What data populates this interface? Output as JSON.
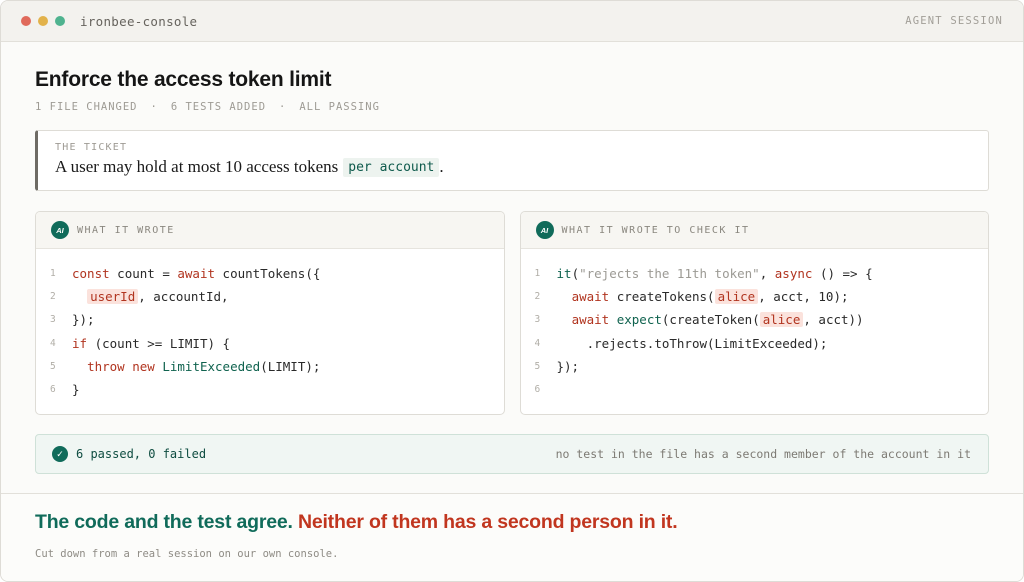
{
  "window": {
    "app_title": "ironbee-console",
    "session_label": "AGENT SESSION",
    "dot_colors": [
      "#e06a5b",
      "#e2b24a",
      "#4fb38f"
    ]
  },
  "header": {
    "title": "Enforce the access token limit",
    "meta": [
      "1 FILE CHANGED",
      "6 TESTS ADDED",
      "ALL PASSING"
    ],
    "meta_separator": "·"
  },
  "ticket": {
    "label": "THE TICKET",
    "text": "A user may hold at most 10 access tokens",
    "code": "per account",
    "trailing": "."
  },
  "panels": [
    {
      "badge": "AI",
      "label": "WHAT IT WROTE",
      "lines": [
        {
          "n": "1",
          "tokens": [
            {
              "t": "const",
              "c": "kw"
            },
            {
              "t": " count = ",
              "c": "plain"
            },
            {
              "t": "await",
              "c": "kw"
            },
            {
              "t": " countTokens({",
              "c": "plain"
            }
          ]
        },
        {
          "n": "2",
          "tokens": [
            {
              "t": "  ",
              "c": "plain"
            },
            {
              "t": "userId",
              "c": "hl"
            },
            {
              "t": ", accountId,",
              "c": "plain"
            }
          ]
        },
        {
          "n": "3",
          "tokens": [
            {
              "t": "});",
              "c": "plain"
            }
          ]
        },
        {
          "n": "4",
          "tokens": [
            {
              "t": "if",
              "c": "kw"
            },
            {
              "t": " (count >= LIMIT) {",
              "c": "plain"
            }
          ]
        },
        {
          "n": "5",
          "tokens": [
            {
              "t": "  ",
              "c": "plain"
            },
            {
              "t": "throw",
              "c": "kw"
            },
            {
              "t": " ",
              "c": "plain"
            },
            {
              "t": "new",
              "c": "kw"
            },
            {
              "t": " ",
              "c": "plain"
            },
            {
              "t": "LimitExceeded",
              "c": "fn"
            },
            {
              "t": "(LIMIT);",
              "c": "plain"
            }
          ]
        },
        {
          "n": "6",
          "tokens": [
            {
              "t": "}",
              "c": "plain"
            }
          ]
        }
      ]
    },
    {
      "badge": "AI",
      "label": "WHAT IT WROTE TO CHECK IT",
      "lines": [
        {
          "n": "1",
          "tokens": [
            {
              "t": "it",
              "c": "fn"
            },
            {
              "t": "(",
              "c": "plain"
            },
            {
              "t": "\"rejects the 11th token\"",
              "c": "str"
            },
            {
              "t": ", ",
              "c": "plain"
            },
            {
              "t": "async",
              "c": "kw"
            },
            {
              "t": " () => {",
              "c": "plain"
            }
          ]
        },
        {
          "n": "2",
          "tokens": [
            {
              "t": "  ",
              "c": "plain"
            },
            {
              "t": "await",
              "c": "kw"
            },
            {
              "t": " createTokens(",
              "c": "plain"
            },
            {
              "t": "alice",
              "c": "hl"
            },
            {
              "t": ", acct, 10);",
              "c": "plain"
            }
          ]
        },
        {
          "n": "3",
          "tokens": [
            {
              "t": "  ",
              "c": "plain"
            },
            {
              "t": "await",
              "c": "kw"
            },
            {
              "t": " ",
              "c": "plain"
            },
            {
              "t": "expect",
              "c": "fn"
            },
            {
              "t": "(createToken(",
              "c": "plain"
            },
            {
              "t": "alice",
              "c": "hl"
            },
            {
              "t": ", acct))",
              "c": "plain"
            }
          ]
        },
        {
          "n": "4",
          "tokens": [
            {
              "t": "    .rejects.toThrow(LimitExceeded);",
              "c": "plain"
            }
          ]
        },
        {
          "n": "5",
          "tokens": [
            {
              "t": "});",
              "c": "plain"
            }
          ]
        },
        {
          "n": "6",
          "tokens": []
        }
      ]
    }
  ],
  "results": {
    "icon": "check-icon",
    "summary": "6 passed, 0 failed",
    "note": "no test in the file has a second member of the account in it"
  },
  "footer": {
    "headline_agree": "The code and the test agree.",
    "headline_neither": "Neither of them has a second person in it.",
    "caption": "Cut down from a real session on our own console."
  }
}
